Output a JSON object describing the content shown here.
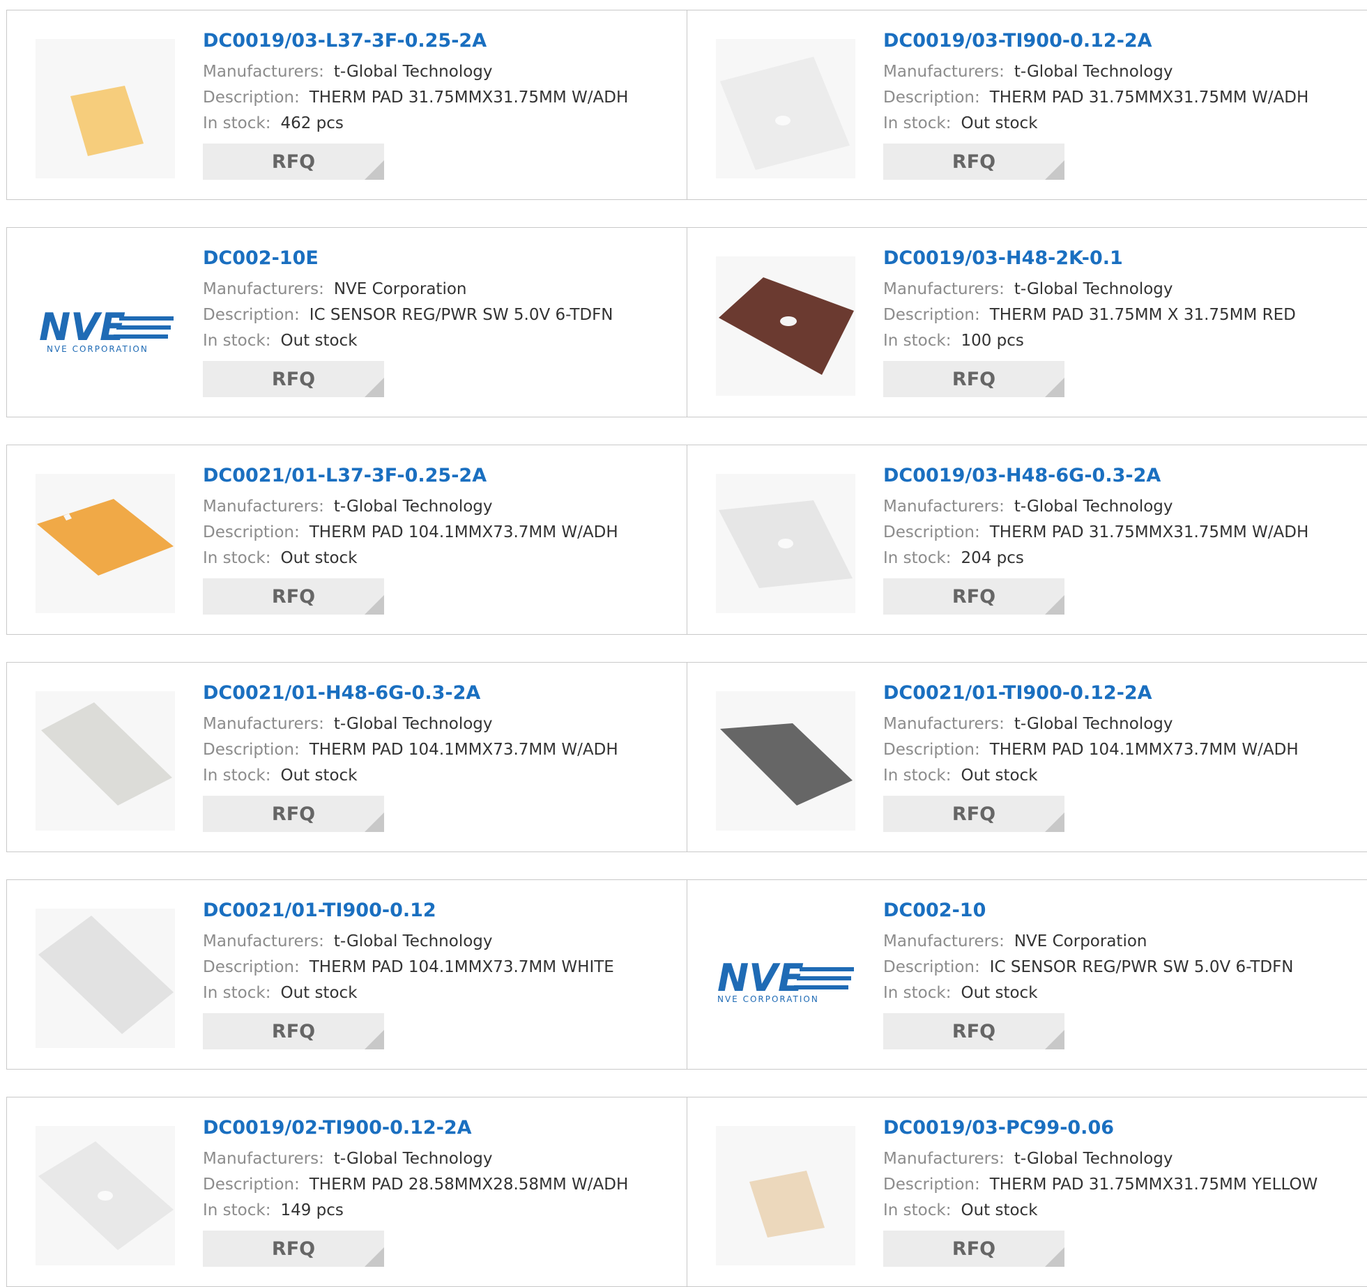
{
  "labels": {
    "manufacturers": "Manufacturers:",
    "description": "Description:",
    "in_stock": "In stock:",
    "rfq": "RFQ"
  },
  "logo_text": {
    "brand": "NVE",
    "sub": "NVE CORPORATION"
  },
  "colors": {
    "link": "#1a6fc0",
    "label": "#8c8c8c",
    "value": "#333333",
    "rfq_bg": "#ececec"
  },
  "products": [
    {
      "part": "DC0019/03-L37-3F-0.25-2A",
      "manufacturer": "t-Global Technology",
      "description": "THERM PAD 31.75MMX31.75MM W/ADH",
      "stock": "462 pcs",
      "image": "small-yellow-pad"
    },
    {
      "part": "DC0019/03-TI900-0.12-2A",
      "manufacturer": "t-Global Technology",
      "description": "THERM PAD 31.75MMX31.75MM W/ADH",
      "stock": "Out stock",
      "image": "white-pad-with-hole"
    },
    {
      "part": "DC002-10E",
      "manufacturer": "NVE Corporation",
      "description": "IC SENSOR REG/PWR SW 5.0V 6-TDFN",
      "stock": "Out stock",
      "image": "nve-logo"
    },
    {
      "part": "DC0019/03-H48-2K-0.1",
      "manufacturer": "t-Global Technology",
      "description": "THERM PAD 31.75MM X 31.75MM RED",
      "stock": "100 pcs",
      "image": "brown-pad-with-hole"
    },
    {
      "part": "DC0021/01-L37-3F-0.25-2A",
      "manufacturer": "t-Global Technology",
      "description": "THERM PAD 104.1MMX73.7MM W/ADH",
      "stock": "Out stock",
      "image": "orange-large-pad"
    },
    {
      "part": "DC0019/03-H48-6G-0.3-2A",
      "manufacturer": "t-Global Technology",
      "description": "THERM PAD 31.75MMX31.75MM W/ADH",
      "stock": "204 pcs",
      "image": "light-grey-pad-with-hole"
    },
    {
      "part": "DC0021/01-H48-6G-0.3-2A",
      "manufacturer": "t-Global Technology",
      "description": "THERM PAD 104.1MMX73.7MM W/ADH",
      "stock": "Out stock",
      "image": "grey-large-pad"
    },
    {
      "part": "DC0021/01-TI900-0.12-2A",
      "manufacturer": "t-Global Technology",
      "description": "THERM PAD 104.1MMX73.7MM W/ADH",
      "stock": "Out stock",
      "image": "dark-grey-large-pad"
    },
    {
      "part": "DC0021/01-TI900-0.12",
      "manufacturer": "t-Global Technology",
      "description": "THERM PAD 104.1MMX73.7MM WHITE",
      "stock": "Out stock",
      "image": "light-large-pad"
    },
    {
      "part": "DC002-10",
      "manufacturer": "NVE Corporation",
      "description": "IC SENSOR REG/PWR SW 5.0V 6-TDFN",
      "stock": "Out stock",
      "image": "nve-logo"
    },
    {
      "part": "DC0019/02-TI900-0.12-2A",
      "manufacturer": "t-Global Technology",
      "description": "THERM PAD 28.58MMX28.58MM W/ADH",
      "stock": "149 pcs",
      "image": "white-pad-with-hole"
    },
    {
      "part": "DC0019/03-PC99-0.06",
      "manufacturer": "t-Global Technology",
      "description": "THERM PAD 31.75MMX31.75MM YELLOW",
      "stock": "Out stock",
      "image": "small-beige-pad"
    }
  ]
}
